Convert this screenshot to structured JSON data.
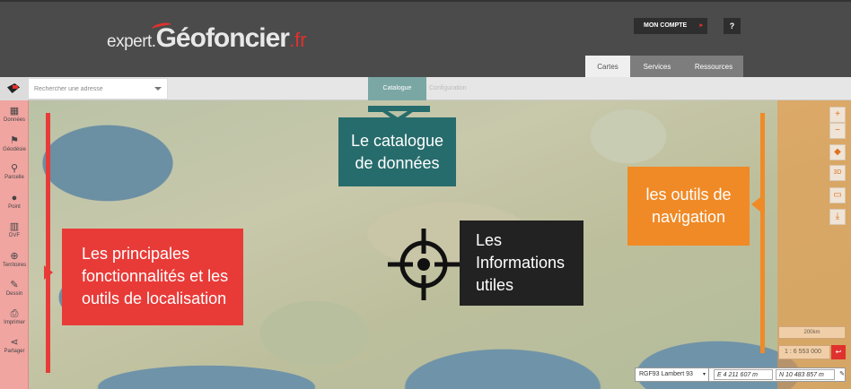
{
  "header": {
    "logo": {
      "prefix": "expert.",
      "main": "Géofoncier",
      "suffix": ".fr"
    },
    "account_button": "MON COMPTE",
    "help_button": "?",
    "tabs": [
      {
        "label": "Cartes",
        "active": true
      },
      {
        "label": "Services",
        "active": false
      },
      {
        "label": "Ressources",
        "active": false
      }
    ]
  },
  "toolbar": {
    "search_placeholder": "Rechercher une adresse",
    "subtabs": [
      {
        "label": "Catalogue",
        "active": true
      },
      {
        "label": "Configuration",
        "active": false
      }
    ]
  },
  "sidebar": {
    "items": [
      {
        "label": "Données",
        "icon": "map-icon"
      },
      {
        "label": "Géodésie",
        "icon": "flag-icon"
      },
      {
        "label": "Parcelle",
        "icon": "search-icon"
      },
      {
        "label": "Point",
        "icon": "pin-icon"
      },
      {
        "label": "DVF",
        "icon": "building-icon"
      },
      {
        "label": "Territoires",
        "icon": "globe-icon"
      },
      {
        "label": "Dessin",
        "icon": "pencil-icon"
      },
      {
        "label": "Imprimer",
        "icon": "printer-icon"
      },
      {
        "label": "Partager",
        "icon": "share-icon"
      }
    ]
  },
  "map_controls": {
    "zoom_in": "+",
    "zoom_out": "−",
    "rotate_3d": "3D",
    "scale_label": "200km",
    "scale_value": "1 : 6 553 000"
  },
  "coordinates": {
    "system": "RGF93 Lambert 93",
    "easting": "E 4 211 607 m",
    "northing": "N 10 483 857 m"
  },
  "callouts": {
    "catalogue": [
      "Le catalogue",
      "de données"
    ],
    "features": [
      "Les principales",
      "fonctionnalités et les",
      "outils de localisation"
    ],
    "info": [
      "Les",
      "Informations",
      "utiles"
    ],
    "navigation": [
      "les outils de",
      "navigation"
    ]
  },
  "colors": {
    "brand_red": "#e0312e",
    "features_red": "#e83b38",
    "catalogue_teal": "#276c6c",
    "info_black": "#222222",
    "nav_orange": "#f08a26"
  }
}
